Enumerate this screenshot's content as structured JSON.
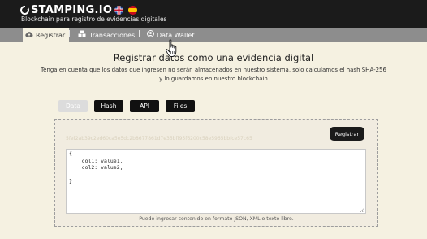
{
  "header": {
    "brand": "STAMPING.IO",
    "tagline": "Blockchain para registro de evidencias digitales",
    "flags": [
      "uk-flag-icon",
      "spain-flag-icon"
    ]
  },
  "nav": {
    "items": [
      {
        "label": "Registrar",
        "icon": "cloud-upload-icon",
        "active": true
      },
      {
        "label": "Transacciones",
        "icon": "cubes-icon",
        "active": false
      },
      {
        "label": "Data Wallet",
        "icon": "user-circle-icon",
        "active": false
      }
    ],
    "separator": "|"
  },
  "main": {
    "title": "Registrar datos como una evidencia digital",
    "subtitle": "Tenga en cuenta que los datos que ingresen no serán almacenados en nuestro sistema, solo calculamos el hash SHA-256 y lo guardamos en nuestro blockchain",
    "tabs": [
      {
        "label": "Data",
        "active": true
      },
      {
        "label": "Hash",
        "active": false
      },
      {
        "label": "API",
        "active": false
      },
      {
        "label": "Files",
        "active": false
      }
    ],
    "hash_value": "5fef2ab39c2ed60ca5e5dc2b8677861d7e35bff95f6200c58e5965bbfce57c65",
    "register_button": "Registrar",
    "editor_content": "{\n    col1: value1,\n    col2: value2,\n    ...\n}",
    "hint": "Puede ingresar contenido en formato JSON, XML o texto libre."
  },
  "colors": {
    "topbar": "#1b1b1b",
    "navbar": "#8d8d8d",
    "background": "#f5f1e1",
    "button": "#111111"
  }
}
